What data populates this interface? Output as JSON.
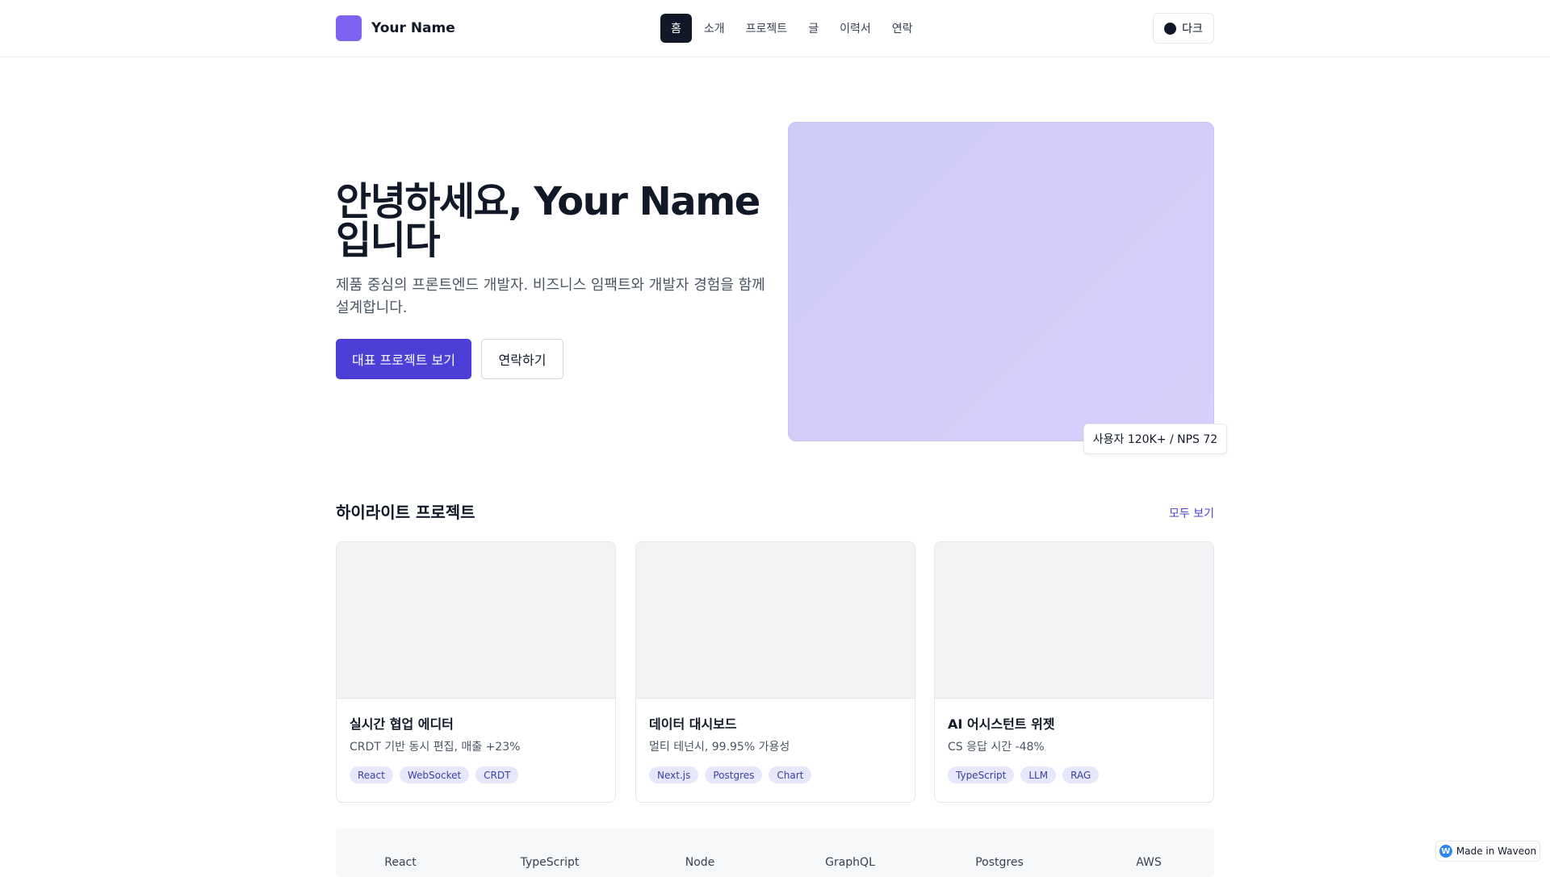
{
  "header": {
    "brand": "Your Name",
    "nav": [
      {
        "label": "홈",
        "active": true
      },
      {
        "label": "소개",
        "active": false
      },
      {
        "label": "프로젝트",
        "active": false
      },
      {
        "label": "글",
        "active": false
      },
      {
        "label": "이력서",
        "active": false
      },
      {
        "label": "연락",
        "active": false
      }
    ],
    "theme_toggle": "다크"
  },
  "hero": {
    "title_line1": "안녕하세요, Your Name",
    "title_line2": "입니다",
    "subtitle": "제품 중심의 프론트엔드 개발자. 비즈니스 임팩트와 개발자 경험을 함께 설계합니다.",
    "primary_cta": "대표 프로젝트 보기",
    "secondary_cta": "연락하기",
    "badge": "사용자 120K+ / NPS 72"
  },
  "highlights": {
    "title": "하이라이트 프로젝트",
    "see_all": "모두 보기",
    "cards": [
      {
        "title": "실시간 협업 에디터",
        "desc": "CRDT 기반 동시 편집, 매출 +23%",
        "tags": [
          "React",
          "WebSocket",
          "CRDT"
        ]
      },
      {
        "title": "데이터 대시보드",
        "desc": "멀티 테넌시, 99.95% 가용성",
        "tags": [
          "Next.js",
          "Postgres",
          "Chart"
        ]
      },
      {
        "title": "AI 어시스턴트 위젯",
        "desc": "CS 응답 시간 -48%",
        "tags": [
          "TypeScript",
          "LLM",
          "RAG"
        ]
      }
    ]
  },
  "stack": [
    "React",
    "TypeScript",
    "Node",
    "GraphQL",
    "Postgres",
    "AWS"
  ],
  "footer_badge": "Made in Waveon",
  "colors": {
    "accent": "#4b3fd7",
    "brand_mark": "#7c62ee",
    "hero_visual": "#d4cdf8"
  }
}
